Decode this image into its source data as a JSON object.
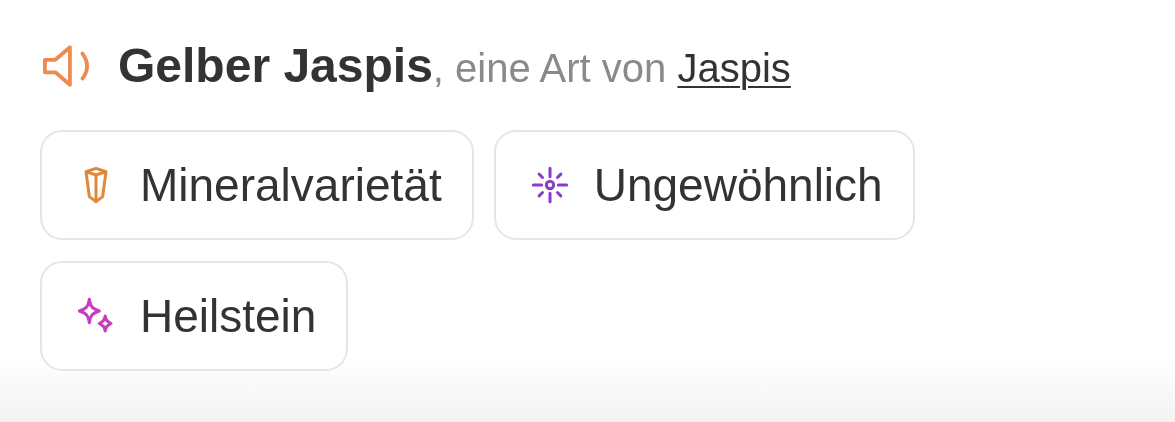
{
  "title": {
    "name": "Gelber Jaspis",
    "connector": ", eine Art von",
    "link": "Jaspis"
  },
  "tags": [
    {
      "label": "Mineralvarietät",
      "kind": "crystal",
      "color": "#e0883a"
    },
    {
      "label": "Ungewöhnlich",
      "kind": "spark",
      "color": "#8a3cc4"
    },
    {
      "label": "Heilstein",
      "kind": "sparkles",
      "color": "#c83cc0"
    }
  ]
}
